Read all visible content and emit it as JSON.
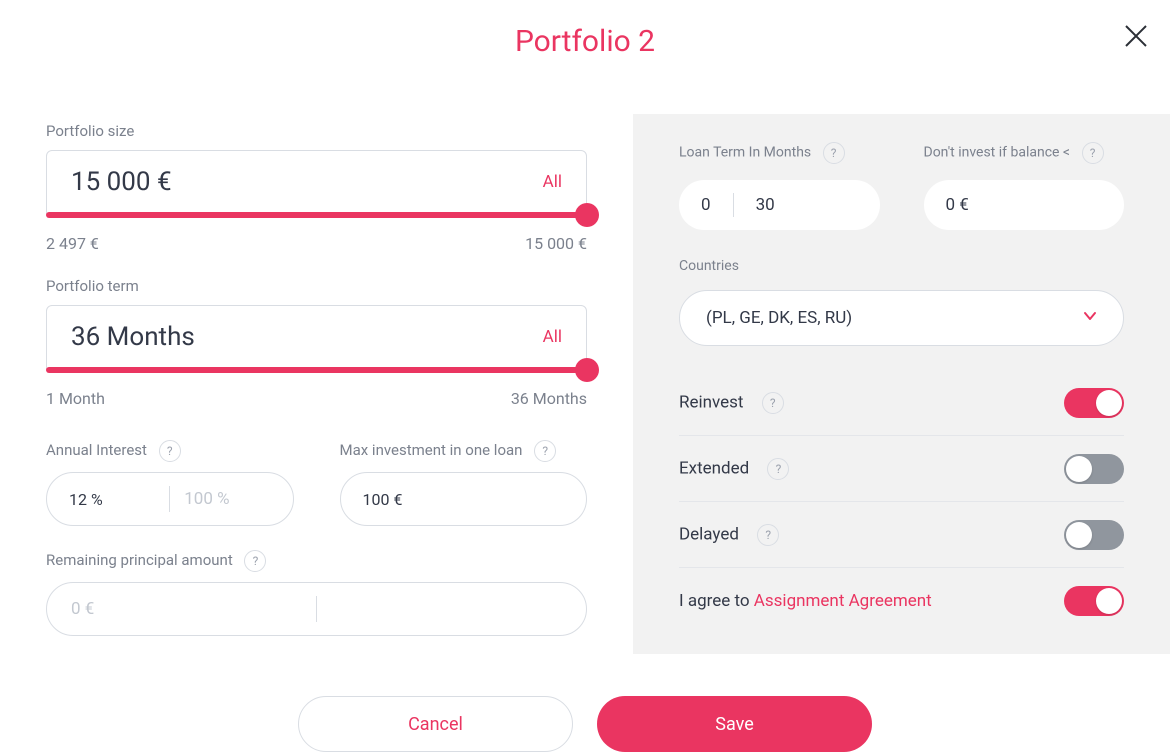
{
  "title": "Portfolio 2",
  "portfolio_size": {
    "label": "Portfolio size",
    "value": "15 000 €",
    "all": "All",
    "min": "2 497 €",
    "max": "15 000 €"
  },
  "portfolio_term": {
    "label": "Portfolio term",
    "value": "36 Months",
    "all": "All",
    "min": "1 Month",
    "max": "36 Months"
  },
  "annual_interest": {
    "label": "Annual Interest",
    "min": "12 %",
    "max_ph": "100 %"
  },
  "max_invest": {
    "label": "Max investment in one loan",
    "value": "100 €"
  },
  "remaining_principal": {
    "label": "Remaining principal amount",
    "placeholder": "0 €"
  },
  "loan_term": {
    "label": "Loan Term In Months",
    "min": "0",
    "max": "30"
  },
  "dont_invest": {
    "label": "Don't invest if balance <",
    "value": "0 €"
  },
  "countries": {
    "label": "Countries",
    "value": "(PL, GE, DK, ES, RU)"
  },
  "toggles": {
    "reinvest": "Reinvest",
    "extended": "Extended",
    "delayed": "Delayed",
    "agree_pre": "I agree to ",
    "agree_link": "Assignment Agreement"
  },
  "help": "?",
  "buttons": {
    "cancel": "Cancel",
    "save": "Save"
  }
}
